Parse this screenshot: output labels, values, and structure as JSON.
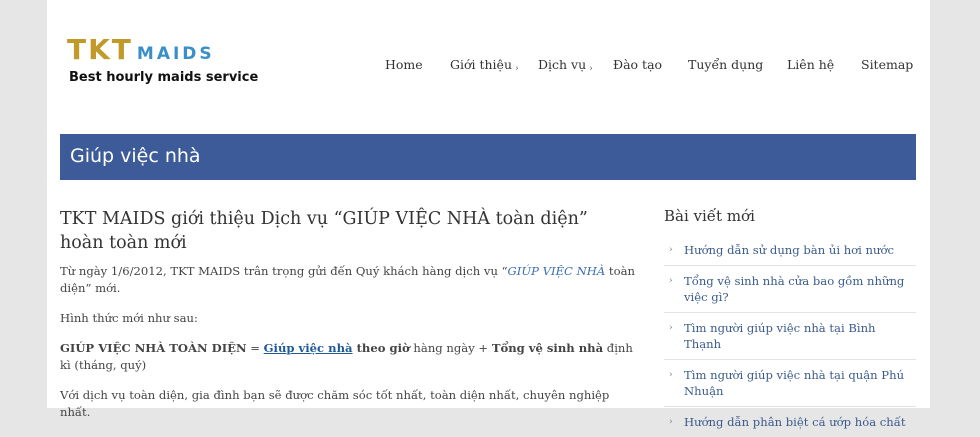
{
  "logo": {
    "main": "TKT",
    "sub": "MAIDS",
    "tagline": "Best hourly maids service"
  },
  "nav": [
    {
      "label": "Home"
    },
    {
      "label": "Giới thiệu",
      "arrow": "›"
    },
    {
      "label": "Dịch vụ",
      "arrow": "›"
    },
    {
      "label": "Đào tạo"
    },
    {
      "label": "Tuyển dụng"
    },
    {
      "label": "Liên hệ"
    },
    {
      "label": "Sitemap"
    }
  ],
  "banner": {
    "title": "Giúp việc nhà"
  },
  "post": {
    "title": "TKT MAIDS giới thiệu Dịch vụ “GIÚP VIỆC NHÀ toàn diện” hoàn toàn mới",
    "p1": {
      "a": "Từ ngày 1/6/2012, TKT MAIDS trân trọng gửi đến Quý khách hàng dịch vụ “",
      "b": "GIÚP VIỆC NHÀ",
      "c": " toàn diện” mới."
    },
    "p2": "Hình thức mới như sau:",
    "p3": {
      "a": "GIÚP VIỆC NHÀ TOÀN DIỆN",
      "b": " = ",
      "c": "Giúp việc nhà",
      "d": " theo giờ",
      "e": " hàng ngày + ",
      "f": "Tổng vệ sinh nhà",
      "g": " định kì (tháng, quý)"
    },
    "p4": "Với dịch vụ toàn diện, gia đình bạn sẽ được chăm sóc tốt nhất, toàn diện nhất, chuyên nghiệp nhất."
  },
  "sidebar": {
    "title": "Bài viết mới",
    "bullet": "›",
    "items": [
      {
        "label": "Hướng dẫn sử dụng bàn ủi hơi nước"
      },
      {
        "label": "Tổng vệ sinh nhà cửa bao gồm những việc gì?"
      },
      {
        "label": "Tìm người giúp việc nhà tại Bình Thạnh"
      },
      {
        "label": "Tìm người giúp việc nhà tại quận Phú Nhuận"
      },
      {
        "label": "Hướng dẫn phân biệt cá ướp hóa chất"
      }
    ]
  },
  "colors": {
    "banner": "#3d5a99",
    "logo_gold": "#c19a2a",
    "logo_blue": "#3a8fc8",
    "link": "#3a5a8c"
  }
}
